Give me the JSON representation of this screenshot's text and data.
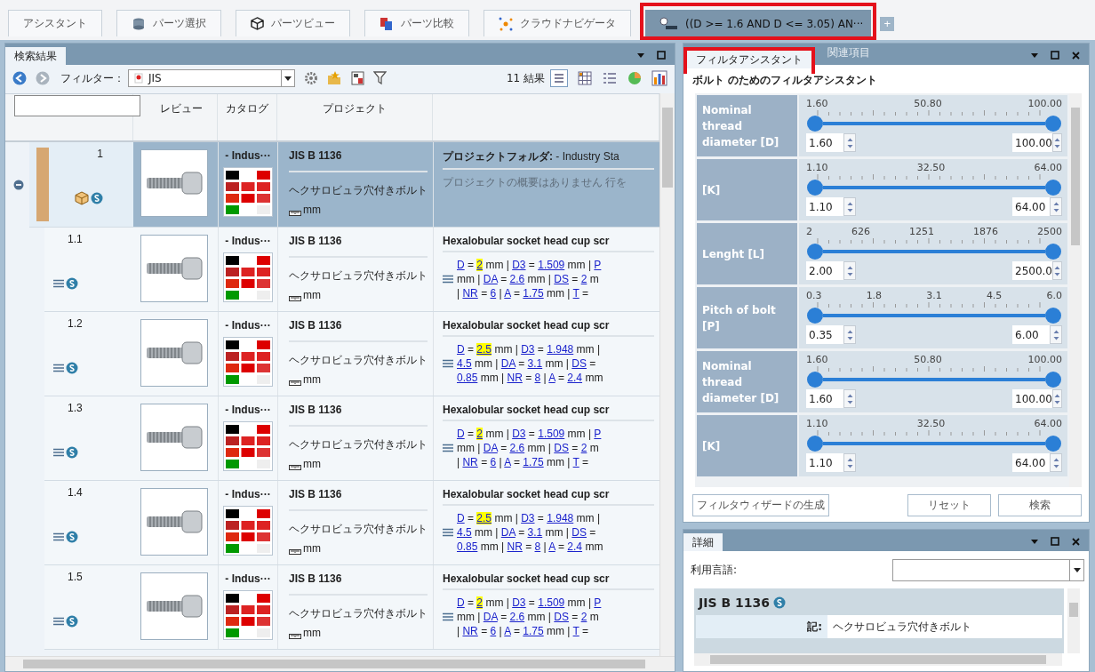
{
  "top_tabs": [
    {
      "label": "アシスタント",
      "selected": false,
      "highlighted": false
    },
    {
      "label": "パーツ選択",
      "selected": false,
      "highlighted": false
    },
    {
      "label": "パーツビュー",
      "selected": false,
      "highlighted": false
    },
    {
      "label": "パーツ比較",
      "selected": false,
      "highlighted": false
    },
    {
      "label": "クラウドナビゲータ",
      "selected": false,
      "highlighted": false
    },
    {
      "label": "((D >= 1.6 AND D <= 3.05) AN···",
      "selected": true,
      "highlighted": true
    }
  ],
  "add_tab_button": "+",
  "results_panel": {
    "title": "検索結果",
    "filter_label": "フィルター：",
    "filter_value": "JIS",
    "result_count": "11 結果",
    "header_preview": "レビュー",
    "header_catalog": "カタログ",
    "header_project": "プロジェクト",
    "rows": [
      {
        "kind": "group",
        "number": "1",
        "selected": true,
        "expanded": true,
        "catalog": "- Indus···",
        "project": "JIS B 1136",
        "name": "ヘクサロビュラ穴付きボルト",
        "unit": "mm",
        "description_title": "**プロジェクトフォルダ:** - Industry Sta",
        "summary": "プロジェクトの概要はありません 行を"
      },
      {
        "kind": "item",
        "number": "1.1",
        "selected": false,
        "catalog": "- Indus···",
        "project": "JIS B 1136",
        "name": "ヘクサロビュラ穴付きボルト",
        "unit": "mm",
        "description_title": "Hexalobular socket head cup scr",
        "parameter_lines": [
          [
            {
              "kind": "link",
              "text": "D",
              "highlighted": false
            },
            {
              "kind": "text",
              "text": " = "
            },
            {
              "kind": "link",
              "text": "2",
              "highlighted": true
            },
            {
              "kind": "text",
              "text": " mm | "
            },
            {
              "kind": "link",
              "text": "D3",
              "highlighted": false
            },
            {
              "kind": "text",
              "text": " = "
            },
            {
              "kind": "link",
              "text": "1.509",
              "highlighted": false
            },
            {
              "kind": "text",
              "text": " mm | "
            },
            {
              "kind": "link",
              "text": "P",
              "highlighted": false
            }
          ],
          [
            {
              "kind": "text",
              "text": "mm | "
            },
            {
              "kind": "link",
              "text": "DA",
              "highlighted": false
            },
            {
              "kind": "text",
              "text": " = "
            },
            {
              "kind": "link",
              "text": "2.6",
              "highlighted": false
            },
            {
              "kind": "text",
              "text": " mm | "
            },
            {
              "kind": "link",
              "text": "DS",
              "highlighted": false
            },
            {
              "kind": "text",
              "text": " = "
            },
            {
              "kind": "link",
              "text": "2",
              "highlighted": false
            },
            {
              "kind": "text",
              "text": " m"
            }
          ],
          [
            {
              "kind": "text",
              "text": "| "
            },
            {
              "kind": "link",
              "text": "NR",
              "highlighted": false
            },
            {
              "kind": "text",
              "text": " = "
            },
            {
              "kind": "link",
              "text": "6",
              "highlighted": false
            },
            {
              "kind": "text",
              "text": " | "
            },
            {
              "kind": "link",
              "text": "A",
              "highlighted": false
            },
            {
              "kind": "text",
              "text": " = "
            },
            {
              "kind": "link",
              "text": "1.75",
              "highlighted": false
            },
            {
              "kind": "text",
              "text": " mm | "
            },
            {
              "kind": "link",
              "text": "T",
              "highlighted": false
            },
            {
              "kind": "text",
              "text": " ="
            }
          ]
        ]
      },
      {
        "kind": "item",
        "number": "1.2",
        "selected": false,
        "catalog": "- Indus···",
        "project": "JIS B 1136",
        "name": "ヘクサロビュラ穴付きボルト",
        "unit": "mm",
        "description_title": "Hexalobular socket head cup scr",
        "parameter_lines": [
          [
            {
              "kind": "link",
              "text": "D",
              "highlighted": false
            },
            {
              "kind": "text",
              "text": " = "
            },
            {
              "kind": "link",
              "text": "2.5",
              "highlighted": true
            },
            {
              "kind": "text",
              "text": " mm | "
            },
            {
              "kind": "link",
              "text": "D3",
              "highlighted": false
            },
            {
              "kind": "text",
              "text": " = "
            },
            {
              "kind": "link",
              "text": "1.948",
              "highlighted": false
            },
            {
              "kind": "text",
              "text": " mm |"
            }
          ],
          [
            {
              "kind": "link",
              "text": "4.5",
              "highlighted": false
            },
            {
              "kind": "text",
              "text": " mm | "
            },
            {
              "kind": "link",
              "text": "DA",
              "highlighted": false
            },
            {
              "kind": "text",
              "text": " = "
            },
            {
              "kind": "link",
              "text": "3.1",
              "highlighted": false
            },
            {
              "kind": "text",
              "text": " mm | "
            },
            {
              "kind": "link",
              "text": "DS",
              "highlighted": false
            },
            {
              "kind": "text",
              "text": " ="
            }
          ],
          [
            {
              "kind": "link",
              "text": "0.85",
              "highlighted": false
            },
            {
              "kind": "text",
              "text": " mm | "
            },
            {
              "kind": "link",
              "text": "NR",
              "highlighted": false
            },
            {
              "kind": "text",
              "text": " = "
            },
            {
              "kind": "link",
              "text": "8",
              "highlighted": false
            },
            {
              "kind": "text",
              "text": " | "
            },
            {
              "kind": "link",
              "text": "A",
              "highlighted": false
            },
            {
              "kind": "text",
              "text": " = "
            },
            {
              "kind": "link",
              "text": "2.4",
              "highlighted": false
            },
            {
              "kind": "text",
              "text": " mm"
            }
          ]
        ]
      },
      {
        "kind": "item",
        "number": "1.3",
        "selected": false,
        "catalog": "- Indus···",
        "project": "JIS B 1136",
        "name": "ヘクサロビュラ穴付きボルト",
        "unit": "mm",
        "description_title": "Hexalobular socket head cup scr",
        "parameter_lines": [
          [
            {
              "kind": "link",
              "text": "D",
              "highlighted": false
            },
            {
              "kind": "text",
              "text": " = "
            },
            {
              "kind": "link",
              "text": "2",
              "highlighted": true
            },
            {
              "kind": "text",
              "text": " mm | "
            },
            {
              "kind": "link",
              "text": "D3",
              "highlighted": false
            },
            {
              "kind": "text",
              "text": " = "
            },
            {
              "kind": "link",
              "text": "1.509",
              "highlighted": false
            },
            {
              "kind": "text",
              "text": " mm | "
            },
            {
              "kind": "link",
              "text": "P",
              "highlighted": false
            }
          ],
          [
            {
              "kind": "text",
              "text": "mm | "
            },
            {
              "kind": "link",
              "text": "DA",
              "highlighted": false
            },
            {
              "kind": "text",
              "text": " = "
            },
            {
              "kind": "link",
              "text": "2.6",
              "highlighted": false
            },
            {
              "kind": "text",
              "text": " mm | "
            },
            {
              "kind": "link",
              "text": "DS",
              "highlighted": false
            },
            {
              "kind": "text",
              "text": " = "
            },
            {
              "kind": "link",
              "text": "2",
              "highlighted": false
            },
            {
              "kind": "text",
              "text": " m"
            }
          ],
          [
            {
              "kind": "text",
              "text": "| "
            },
            {
              "kind": "link",
              "text": "NR",
              "highlighted": false
            },
            {
              "kind": "text",
              "text": " = "
            },
            {
              "kind": "link",
              "text": "6",
              "highlighted": false
            },
            {
              "kind": "text",
              "text": " | "
            },
            {
              "kind": "link",
              "text": "A",
              "highlighted": false
            },
            {
              "kind": "text",
              "text": " = "
            },
            {
              "kind": "link",
              "text": "1.75",
              "highlighted": false
            },
            {
              "kind": "text",
              "text": " mm | "
            },
            {
              "kind": "link",
              "text": "T",
              "highlighted": false
            },
            {
              "kind": "text",
              "text": " ="
            }
          ]
        ]
      },
      {
        "kind": "item",
        "number": "1.4",
        "selected": false,
        "catalog": "- Indus···",
        "project": "JIS B 1136",
        "name": "ヘクサロビュラ穴付きボルト",
        "unit": "mm",
        "description_title": "Hexalobular socket head cup scr",
        "parameter_lines": [
          [
            {
              "kind": "link",
              "text": "D",
              "highlighted": false
            },
            {
              "kind": "text",
              "text": " = "
            },
            {
              "kind": "link",
              "text": "2.5",
              "highlighted": true
            },
            {
              "kind": "text",
              "text": " mm | "
            },
            {
              "kind": "link",
              "text": "D3",
              "highlighted": false
            },
            {
              "kind": "text",
              "text": " = "
            },
            {
              "kind": "link",
              "text": "1.948",
              "highlighted": false
            },
            {
              "kind": "text",
              "text": " mm |"
            }
          ],
          [
            {
              "kind": "link",
              "text": "4.5",
              "highlighted": false
            },
            {
              "kind": "text",
              "text": " mm | "
            },
            {
              "kind": "link",
              "text": "DA",
              "highlighted": false
            },
            {
              "kind": "text",
              "text": " = "
            },
            {
              "kind": "link",
              "text": "3.1",
              "highlighted": false
            },
            {
              "kind": "text",
              "text": " mm | "
            },
            {
              "kind": "link",
              "text": "DS",
              "highlighted": false
            },
            {
              "kind": "text",
              "text": " ="
            }
          ],
          [
            {
              "kind": "link",
              "text": "0.85",
              "highlighted": false
            },
            {
              "kind": "text",
              "text": " mm | "
            },
            {
              "kind": "link",
              "text": "NR",
              "highlighted": false
            },
            {
              "kind": "text",
              "text": " = "
            },
            {
              "kind": "link",
              "text": "8",
              "highlighted": false
            },
            {
              "kind": "text",
              "text": " | "
            },
            {
              "kind": "link",
              "text": "A",
              "highlighted": false
            },
            {
              "kind": "text",
              "text": " = "
            },
            {
              "kind": "link",
              "text": "2.4",
              "highlighted": false
            },
            {
              "kind": "text",
              "text": " mm"
            }
          ]
        ]
      },
      {
        "kind": "item",
        "number": "1.5",
        "selected": false,
        "catalog": "- Indus···",
        "project": "JIS B 1136",
        "name": "ヘクサロビュラ穴付きボルト",
        "unit": "mm",
        "description_title": "Hexalobular socket head cup scr",
        "parameter_lines": [
          [
            {
              "kind": "link",
              "text": "D",
              "highlighted": false
            },
            {
              "kind": "text",
              "text": " = "
            },
            {
              "kind": "link",
              "text": "2",
              "highlighted": true
            },
            {
              "kind": "text",
              "text": " mm | "
            },
            {
              "kind": "link",
              "text": "D3",
              "highlighted": false
            },
            {
              "kind": "text",
              "text": " = "
            },
            {
              "kind": "link",
              "text": "1.509",
              "highlighted": false
            },
            {
              "kind": "text",
              "text": " mm | "
            },
            {
              "kind": "link",
              "text": "P",
              "highlighted": false
            }
          ],
          [
            {
              "kind": "text",
              "text": "mm | "
            },
            {
              "kind": "link",
              "text": "DA",
              "highlighted": false
            },
            {
              "kind": "text",
              "text": " = "
            },
            {
              "kind": "link",
              "text": "2.6",
              "highlighted": false
            },
            {
              "kind": "text",
              "text": " mm | "
            },
            {
              "kind": "link",
              "text": "DS",
              "highlighted": false
            },
            {
              "kind": "text",
              "text": " = "
            },
            {
              "kind": "link",
              "text": "2",
              "highlighted": false
            },
            {
              "kind": "text",
              "text": " m"
            }
          ],
          [
            {
              "kind": "text",
              "text": "| "
            },
            {
              "kind": "link",
              "text": "NR",
              "highlighted": false
            },
            {
              "kind": "text",
              "text": " = "
            },
            {
              "kind": "link",
              "text": "6",
              "highlighted": false
            },
            {
              "kind": "text",
              "text": " | "
            },
            {
              "kind": "link",
              "text": "A",
              "highlighted": false
            },
            {
              "kind": "text",
              "text": " = "
            },
            {
              "kind": "link",
              "text": "1.75",
              "highlighted": false
            },
            {
              "kind": "text",
              "text": " mm | "
            },
            {
              "kind": "link",
              "text": "T",
              "highlighted": false
            },
            {
              "kind": "text",
              "text": " ="
            }
          ]
        ]
      }
    ]
  },
  "filter_panel": {
    "tabs": [
      {
        "label": "フィルタアシスタント",
        "selected": true,
        "highlighted": true
      },
      {
        "label": "関連項目",
        "selected": false,
        "highlighted": false
      }
    ],
    "heading": "ボルト のためのフィルタアシスタント",
    "filters": [
      {
        "label": "Nominal thread diameter [D]",
        "ticks": [
          "1.60",
          "50.80",
          "100.00"
        ],
        "thumbs": [
          {
            "level": 0
          },
          {
            "level": 1
          }
        ],
        "min": "1.60",
        "max": "100.00"
      },
      {
        "label": "[K]",
        "ticks": [
          "1.10",
          "32.50",
          "64.00"
        ],
        "thumbs": [
          {
            "level": 0
          },
          {
            "level": 1
          }
        ],
        "min": "1.10",
        "max": "64.00"
      },
      {
        "label": "Lenght [L]",
        "ticks": [
          "2",
          "626",
          "1251",
          "1876",
          "2500"
        ],
        "thumbs": [
          {
            "level": 0
          },
          {
            "level": 1
          }
        ],
        "min": "2.00",
        "max": "2500.0"
      },
      {
        "label": "Pitch of bolt [P]",
        "ticks": [
          "0.3",
          "1.8",
          "3.1",
          "4.5",
          "6.0"
        ],
        "thumbs": [
          {
            "level": 0
          },
          {
            "level": 1
          }
        ],
        "min": "0.35",
        "max": "6.00"
      },
      {
        "label": "Nominal thread diameter [D]",
        "ticks": [
          "1.60",
          "50.80",
          "100.00"
        ],
        "thumbs": [
          {
            "level": 0
          },
          {
            "level": 1
          }
        ],
        "min": "1.60",
        "max": "100.00"
      },
      {
        "label": "[K]",
        "ticks": [
          "1.10",
          "32.50",
          "64.00"
        ],
        "thumbs": [
          {
            "level": 0
          },
          {
            "level": 1
          }
        ],
        "min": "1.10",
        "max": "64.00"
      }
    ],
    "buttons": [
      "フィルタウィザードの生成",
      "リセット",
      "検索"
    ]
  },
  "details_panel": {
    "title": "詳細",
    "language_label": "利用言語:",
    "card_title": "JIS B 1136",
    "fields": [
      {
        "label": "記:",
        "value": "ヘクサロビュラ穴付きボルト"
      }
    ]
  }
}
